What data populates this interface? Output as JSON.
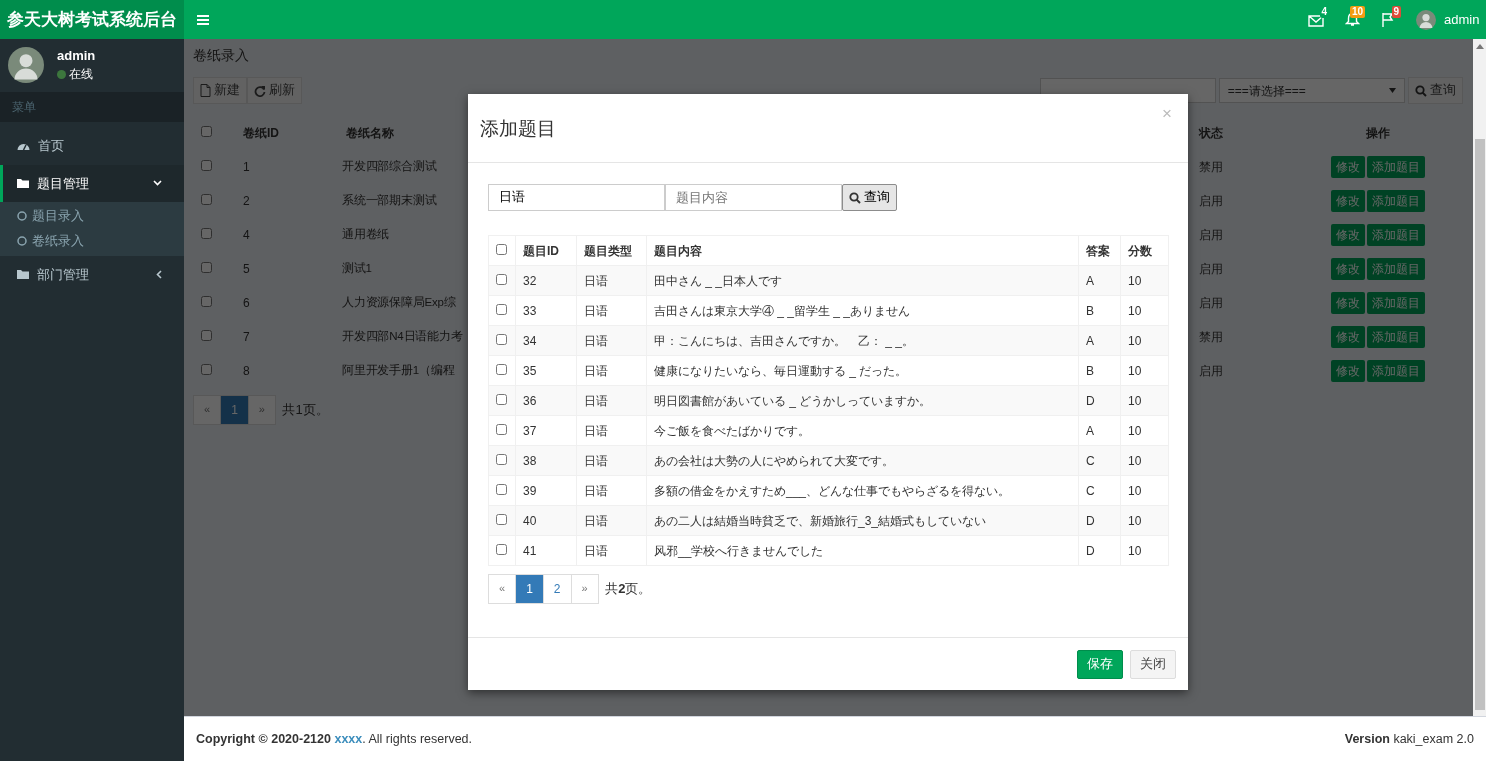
{
  "navbar": {
    "brand": "参天大树考试系统后台",
    "user": "admin",
    "indicators": [
      {
        "kind": "mail",
        "count": "4",
        "color": "#00a65a"
      },
      {
        "kind": "bell",
        "count": "10",
        "color": "#f39c12"
      },
      {
        "kind": "flag",
        "count": "9",
        "color": "#dd4b39"
      }
    ]
  },
  "sidebar": {
    "user": {
      "name": "admin",
      "status": "在线"
    },
    "header": "菜单",
    "items": [
      {
        "label": "首页",
        "kind": "dashboard",
        "selected": false
      },
      {
        "label": "题目管理",
        "kind": "folder",
        "selected": true,
        "expanded": true,
        "children": [
          {
            "label": "题目录入",
            "selected": false
          },
          {
            "label": "卷纸录入",
            "selected": false
          }
        ]
      },
      {
        "label": "部门管理",
        "kind": "folder",
        "selected": false,
        "expanded": false
      }
    ]
  },
  "page": {
    "breadcrumb": "卷纸录入",
    "toolbar": [
      {
        "label": "新建",
        "kind": "new"
      },
      {
        "label": "刷新",
        "kind": "refresh"
      }
    ],
    "filter": {
      "value": "===请选择==="
    },
    "search_button": "查询",
    "table": {
      "all_checked": false,
      "columns": [
        "卷纸ID",
        "卷纸名称",
        "状态",
        "操作"
      ],
      "rows": [
        {
          "checked": false,
          "id": "1",
          "name": "开发四部综合测试",
          "status": "禁用",
          "actions": [
            "修改",
            "添加题目"
          ]
        },
        {
          "checked": false,
          "id": "2",
          "name": "系统一部期末测试",
          "status": "启用",
          "actions": [
            "修改",
            "添加题目"
          ]
        },
        {
          "checked": false,
          "id": "4",
          "name": "通用卷纸",
          "status": "启用",
          "actions": [
            "修改",
            "添加题目"
          ]
        },
        {
          "checked": false,
          "id": "5",
          "name": "测试1",
          "status": "启用",
          "actions": [
            "修改",
            "添加题目"
          ]
        },
        {
          "checked": false,
          "id": "6",
          "name": "人力资源保障局Exp综",
          "status": "启用",
          "actions": [
            "修改",
            "添加题目"
          ]
        },
        {
          "checked": false,
          "id": "7",
          "name": "开发四部N4日语能力考",
          "status": "禁用",
          "actions": [
            "修改",
            "添加题目"
          ]
        },
        {
          "checked": false,
          "id": "8",
          "name": "阿里开发手册1（编程",
          "status": "启用",
          "actions": [
            "修改",
            "添加题目"
          ]
        }
      ]
    },
    "pagination": {
      "prev": "«",
      "next": "»",
      "pages": [
        {
          "label": "1",
          "selected": true
        }
      ],
      "summary": "共1页。"
    }
  },
  "modal": {
    "title": "添加题目",
    "close": "×",
    "type_field": {
      "value": "日语"
    },
    "content_field": {
      "placeholder": "题目内容"
    },
    "search_button": "查询",
    "table": {
      "all_checked": false,
      "columns": [
        "题目ID",
        "题目类型",
        "题目内容",
        "答案",
        "分数"
      ],
      "rows": [
        {
          "checked": false,
          "cells": [
            "32",
            "日语",
            "田中さん _ _日本人です",
            "A",
            "10"
          ]
        },
        {
          "checked": false,
          "cells": [
            "33",
            "日语",
            "吉田さんは東京大学④ _ _留学生 _ _ありません",
            "B",
            "10"
          ]
        },
        {
          "checked": false,
          "cells": [
            "34",
            "日语",
            "甲：こんにちは、吉田さんですか。　乙： _ _。",
            "A",
            "10"
          ]
        },
        {
          "checked": false,
          "cells": [
            "35",
            "日语",
            "健康になりたいなら、毎日運動する _ だった。",
            "B",
            "10"
          ]
        },
        {
          "checked": false,
          "cells": [
            "36",
            "日语",
            "明日図書館があいている _ どうかしっていますか。",
            "D",
            "10"
          ]
        },
        {
          "checked": false,
          "cells": [
            "37",
            "日语",
            "今ご飯を食べたばかりです。",
            "A",
            "10"
          ]
        },
        {
          "checked": false,
          "cells": [
            "38",
            "日语",
            "あの会社は大勢の人にやめられて大変です。",
            "C",
            "10"
          ]
        },
        {
          "checked": false,
          "cells": [
            "39",
            "日语",
            "多額の借金をかえすため___、どんな仕事でもやらざるを得ない。",
            "C",
            "10"
          ]
        },
        {
          "checked": false,
          "cells": [
            "40",
            "日语",
            "あの二人は結婚当時貧乏で、新婚旅行_3_結婚式もしていない",
            "D",
            "10"
          ]
        },
        {
          "checked": false,
          "cells": [
            "41",
            "日语",
            "风邪__学校へ行きませんでした",
            "D",
            "10"
          ]
        }
      ]
    },
    "pagination": {
      "prev": "«",
      "next": "»",
      "pages": [
        {
          "label": "1",
          "selected": true
        },
        {
          "label": "2",
          "selected": false
        }
      ],
      "summary": "共**2**页。"
    },
    "buttons": [
      {
        "label": "保存",
        "kind": "primary"
      },
      {
        "label": "关闭",
        "kind": "secondary"
      }
    ]
  },
  "footer": {
    "copyright": "Copyright © 2020-2120",
    "link": "xxxx",
    "rights": ". All rights reserved.",
    "version_label": "Version",
    "version": "kaki_exam 2.0"
  }
}
